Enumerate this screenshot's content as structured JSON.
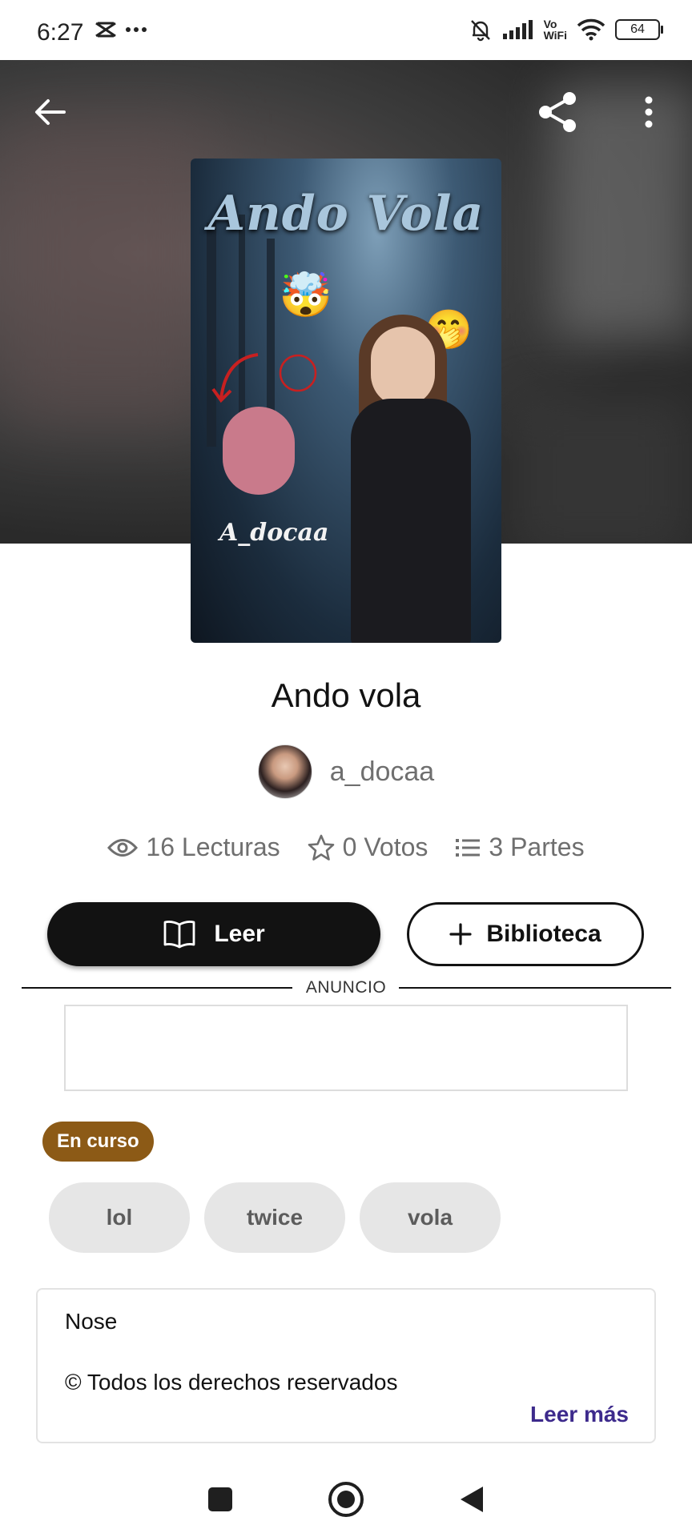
{
  "status_bar": {
    "time": "6:27",
    "battery": "64",
    "icons": [
      "capcut-icon",
      "more-dots-icon",
      "mute-icon",
      "signal-icon",
      "vowifi-icon",
      "wifi-icon",
      "battery-icon"
    ],
    "vowifi_label_top": "Vo",
    "vowifi_label_bottom": "WiFi"
  },
  "header": {
    "back_icon": "arrow-left-icon",
    "share_icon": "share-icon",
    "menu_icon": "more-vertical-icon"
  },
  "cover": {
    "title": "Ando Vola",
    "author_mark": "A_docaa"
  },
  "story": {
    "title": "Ando vola",
    "author": "a_docaa",
    "stats": {
      "reads": "16 Lecturas",
      "votes": "0 Votos",
      "parts": "3 Partes"
    }
  },
  "actions": {
    "read_label": "Leer",
    "library_label": "Biblioteca"
  },
  "ad": {
    "label": "ANUNCIO"
  },
  "status_chip": "En curso",
  "tags": [
    "lol",
    "twice",
    "vola"
  ],
  "description": {
    "line1": "Nose",
    "line2": "© Todos los derechos reservados",
    "read_more": "Leer más"
  },
  "colors": {
    "status_chip": "#8c5a16",
    "read_more": "#3d2a8c",
    "primary_button": "#121212"
  }
}
